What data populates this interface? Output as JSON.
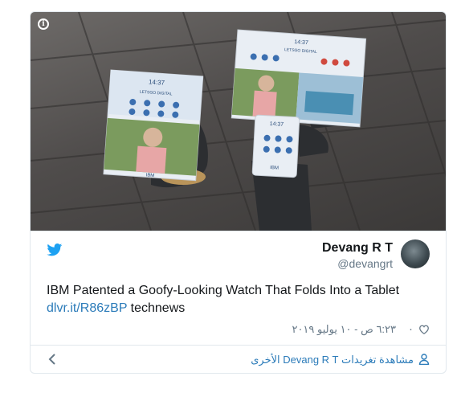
{
  "tweet": {
    "author_name": "Devang R T",
    "author_handle": "@devangrt",
    "text": "IBM Patented a Goofy-Looking Watch That Folds Into a Tablet",
    "link_text": "dlvr.it/R86zBP",
    "hashtag_text": "technews",
    "like_count": "٠",
    "timestamp": "٦:٢٣ ص - ١٠ يوليو ٢٠١٩",
    "footer_link": "مشاهدة تغريدات Devang R T الأخرى"
  },
  "media": {
    "watch_time": "14:37",
    "watch_brand": "IBM",
    "screen_label": "LETSGO DIGITAL"
  },
  "colors": {
    "twitter_blue": "#1da1f2",
    "link_blue": "#2b7bb9",
    "muted": "#657786",
    "border": "#e1e8ed"
  },
  "icons": [
    "info-icon",
    "twitter-bird-icon",
    "heart-icon",
    "user-icon",
    "chevron-left-icon"
  ]
}
